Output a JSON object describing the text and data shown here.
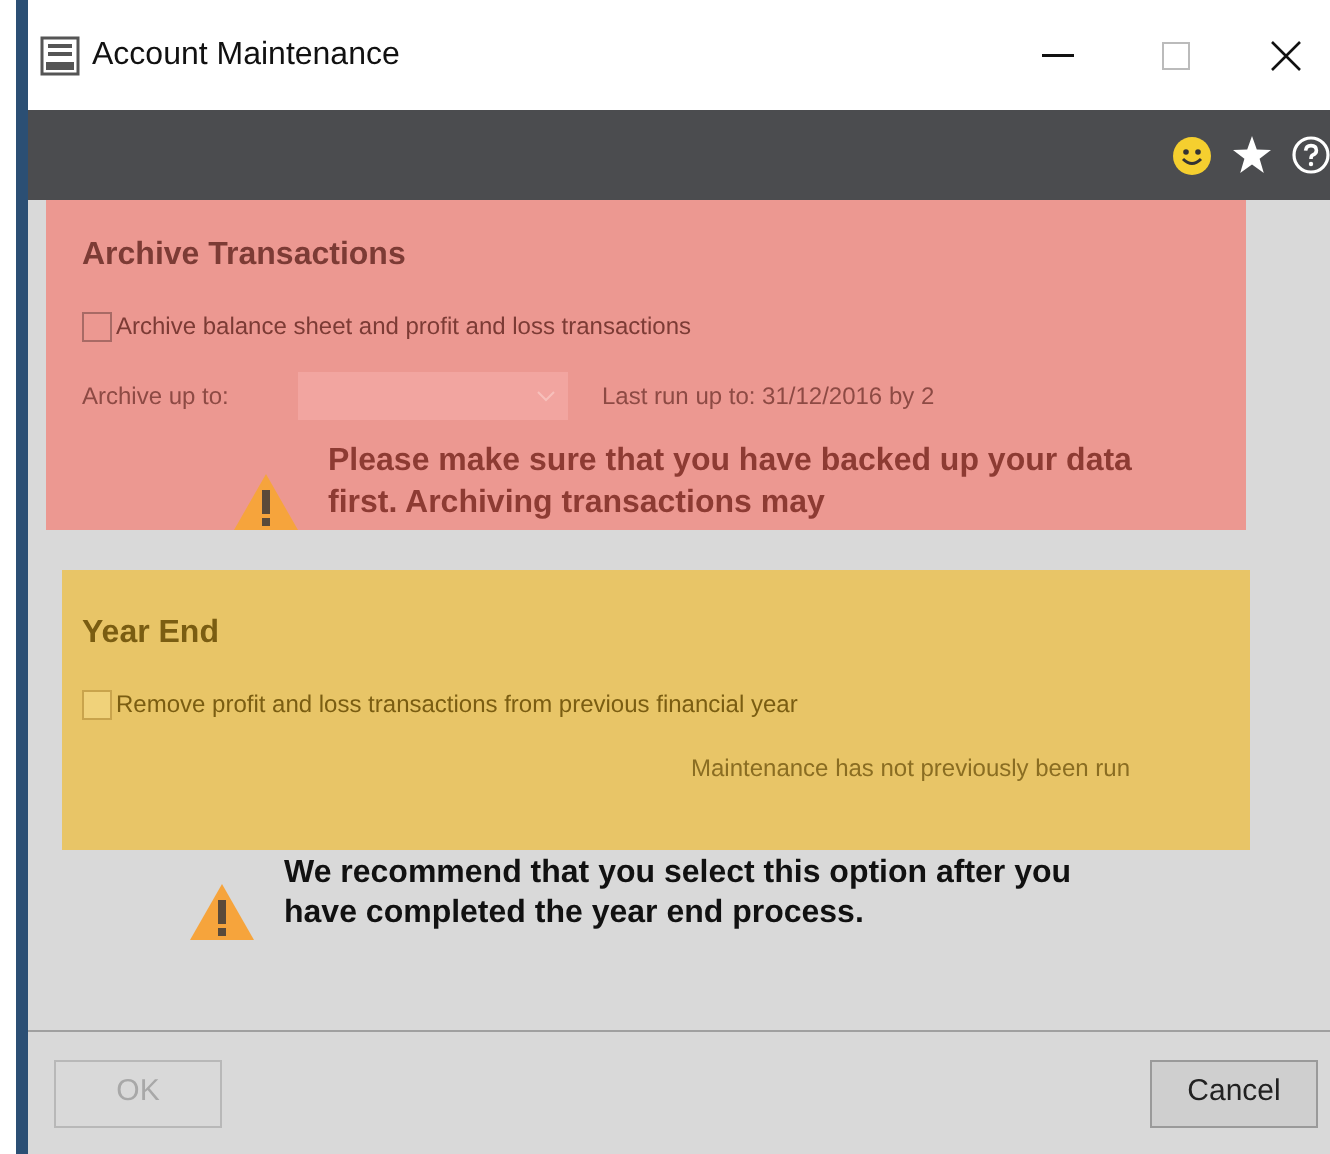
{
  "window": {
    "title": "Account Maintenance"
  },
  "archive": {
    "title": "Archive Transactions",
    "checkbox": {
      "label": "Archive balance sheet and profit and loss transactions",
      "checked": false
    },
    "archive_up_to": {
      "label": "Archive up to:",
      "disabled": true
    },
    "last_run": "Last run up to: 31/12/2016 by 2",
    "warning": "Please make sure that you have backed up your data first. Archiving transactions may"
  },
  "year_end": {
    "title": "Year End",
    "checkbox": {
      "label": "Remove profit and loss transactions from previous financial year",
      "checked": false
    },
    "status": "Maintenance has not previously been run",
    "warning": "We recommend that you select this option after you have completed the year end process."
  },
  "buttons": [
    {
      "label": "OK",
      "disabled": true
    },
    {
      "label": "Cancel",
      "disabled": false
    }
  ]
}
